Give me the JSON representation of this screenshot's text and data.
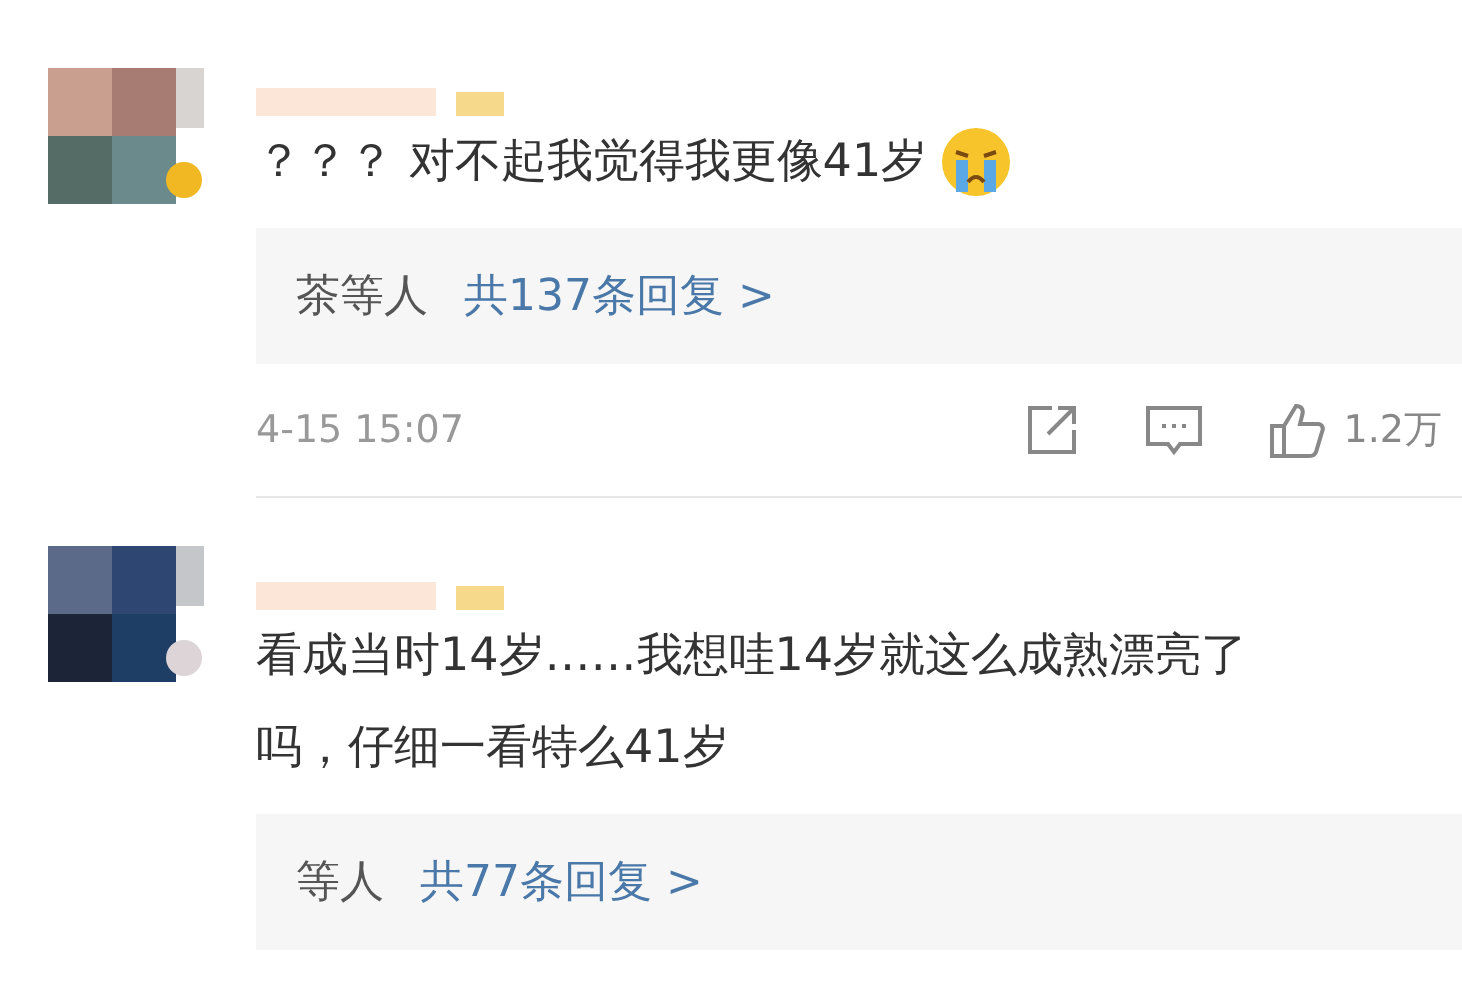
{
  "comments": [
    {
      "text": "？？？ 对不起我觉得我更像41岁",
      "emoji": true,
      "replies": {
        "names": "茶等人",
        "count": "共137条回复 >"
      },
      "time": "4-15 15:07",
      "likes": "1.2万"
    },
    {
      "text": "看成当时14岁……我想哇14岁就这么成熟漂亮了吗，仔细一看特么41岁",
      "emoji": false,
      "replies": {
        "names": "等人",
        "count": "共77条回复 >"
      }
    }
  ]
}
